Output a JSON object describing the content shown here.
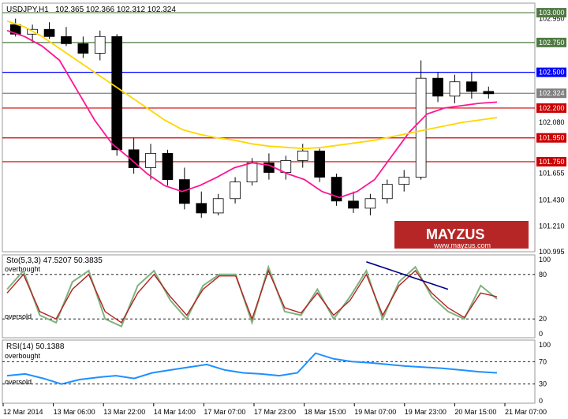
{
  "header": {
    "symbol_label": "USDJPY,H1",
    "ohlc_label": "102.365 102.366 102.312 102.324"
  },
  "brand": {
    "logo_text": "MAYZUS",
    "url": "www.mayzus.com"
  },
  "colors": {
    "candle_up": "#ffffff",
    "candle_down": "#000000",
    "candle_outline": "#000000",
    "fast_ma": "#ff1493",
    "slow_ma": "#ffd700",
    "sto_main": "#7fb27f",
    "sto_signal": "#b22222",
    "rsi_line": "#1e90ff",
    "trend_line": "#00008b",
    "level_green": "#4f7942",
    "level_blue": "#0000ff",
    "level_red": "#cc0000",
    "level_gray": "#808080"
  },
  "chart_data": [
    {
      "type": "candlestick",
      "panel": "price",
      "timeframe": "H1",
      "ylim": [
        100.995,
        103.08
      ],
      "y_ticks": [
        "103.000",
        "102.950",
        "102.750",
        "102.500",
        "102.324",
        "102.200",
        "102.080",
        "101.950",
        "101.750",
        "101.655",
        "101.430",
        "101.210",
        "100.995"
      ],
      "grid": false,
      "moving_averages": [
        {
          "color": "#ff1493",
          "values": [
            102.85,
            102.8,
            102.72,
            102.6,
            102.35,
            102.1,
            101.9,
            101.78,
            101.65,
            101.55,
            101.5,
            101.55,
            101.62,
            101.7,
            101.74,
            101.72,
            101.65,
            101.6,
            101.5,
            101.45,
            101.5,
            101.6,
            101.8,
            102.0,
            102.15,
            102.2,
            102.22,
            102.24,
            102.25
          ]
        },
        {
          "color": "#ffd700",
          "values": [
            102.93,
            102.88,
            102.8,
            102.7,
            102.6,
            102.5,
            102.4,
            102.3,
            102.2,
            102.1,
            102.02,
            101.98,
            101.95,
            101.93,
            101.9,
            101.88,
            101.87,
            101.86,
            101.87,
            101.89,
            101.91,
            101.93,
            101.96,
            101.99,
            102.02,
            102.05,
            102.08,
            102.1,
            102.12
          ]
        }
      ],
      "candles": [
        {
          "o": 102.9,
          "h": 102.95,
          "l": 102.8,
          "c": 102.82
        },
        {
          "o": 102.82,
          "h": 102.9,
          "l": 102.75,
          "c": 102.86
        },
        {
          "o": 102.86,
          "h": 102.92,
          "l": 102.78,
          "c": 102.8
        },
        {
          "o": 102.8,
          "h": 102.88,
          "l": 102.72,
          "c": 102.74
        },
        {
          "o": 102.74,
          "h": 102.8,
          "l": 102.62,
          "c": 102.66
        },
        {
          "o": 102.66,
          "h": 102.85,
          "l": 102.6,
          "c": 102.8
        },
        {
          "o": 102.8,
          "h": 102.82,
          "l": 101.8,
          "c": 101.85
        },
        {
          "o": 101.85,
          "h": 101.95,
          "l": 101.65,
          "c": 101.7
        },
        {
          "o": 101.7,
          "h": 101.9,
          "l": 101.6,
          "c": 101.82
        },
        {
          "o": 101.82,
          "h": 101.85,
          "l": 101.55,
          "c": 101.6
        },
        {
          "o": 101.6,
          "h": 101.7,
          "l": 101.35,
          "c": 101.4
        },
        {
          "o": 101.4,
          "h": 101.5,
          "l": 101.28,
          "c": 101.32
        },
        {
          "o": 101.32,
          "h": 101.48,
          "l": 101.3,
          "c": 101.44
        },
        {
          "o": 101.44,
          "h": 101.62,
          "l": 101.4,
          "c": 101.58
        },
        {
          "o": 101.58,
          "h": 101.78,
          "l": 101.55,
          "c": 101.74
        },
        {
          "o": 101.74,
          "h": 101.82,
          "l": 101.6,
          "c": 101.66
        },
        {
          "o": 101.66,
          "h": 101.8,
          "l": 101.6,
          "c": 101.76
        },
        {
          "o": 101.76,
          "h": 101.9,
          "l": 101.7,
          "c": 101.84
        },
        {
          "o": 101.84,
          "h": 101.86,
          "l": 101.58,
          "c": 101.62
        },
        {
          "o": 101.62,
          "h": 101.65,
          "l": 101.38,
          "c": 101.42
        },
        {
          "o": 101.42,
          "h": 101.5,
          "l": 101.32,
          "c": 101.36
        },
        {
          "o": 101.36,
          "h": 101.48,
          "l": 101.3,
          "c": 101.44
        },
        {
          "o": 101.44,
          "h": 101.6,
          "l": 101.4,
          "c": 101.56
        },
        {
          "o": 101.56,
          "h": 101.68,
          "l": 101.5,
          "c": 101.62
        },
        {
          "o": 101.62,
          "h": 102.6,
          "l": 101.6,
          "c": 102.45
        },
        {
          "o": 102.45,
          "h": 102.5,
          "l": 102.25,
          "c": 102.3
        },
        {
          "o": 102.3,
          "h": 102.48,
          "l": 102.24,
          "c": 102.42
        },
        {
          "o": 102.42,
          "h": 102.5,
          "l": 102.28,
          "c": 102.34
        },
        {
          "o": 102.34,
          "h": 102.38,
          "l": 102.28,
          "c": 102.32
        }
      ],
      "levels": [
        {
          "label": "103.000",
          "value": 103.0,
          "color": "#4f7942"
        },
        {
          "label": "102.750",
          "value": 102.75,
          "color": "#4f7942"
        },
        {
          "label": "102.500",
          "value": 102.5,
          "color": "#0000ff"
        },
        {
          "label": "102.324",
          "value": 102.324,
          "color": "#808080"
        },
        {
          "label": "102.200",
          "value": 102.2,
          "color": "#cc0000"
        },
        {
          "label": "101.950",
          "value": 101.95,
          "color": "#cc0000"
        },
        {
          "label": "101.750",
          "value": 101.75,
          "color": "#cc0000"
        }
      ]
    },
    {
      "type": "line",
      "panel": "stochastic",
      "title": "Sto(5,3,3) 47.5207 50.3835",
      "ylim": [
        0,
        100
      ],
      "y_ticks": [
        "100",
        "80",
        "20",
        "0"
      ],
      "zone_labels": [
        "overbought",
        "oversold"
      ],
      "series": [
        {
          "values": [
            60,
            85,
            25,
            15,
            70,
            85,
            20,
            10,
            65,
            85,
            45,
            20,
            65,
            80,
            80,
            15,
            90,
            30,
            25,
            60,
            20,
            50,
            85,
            20,
            70,
            90,
            50,
            30,
            20,
            65,
            47
          ]
        },
        {
          "values": [
            55,
            80,
            30,
            20,
            60,
            80,
            30,
            15,
            55,
            80,
            50,
            25,
            60,
            78,
            78,
            20,
            85,
            35,
            28,
            55,
            25,
            45,
            80,
            25,
            65,
            85,
            55,
            35,
            22,
            55,
            50
          ]
        }
      ],
      "trend_line": [
        {
          "x": 22,
          "y": 97
        },
        {
          "x": 27,
          "y": 60
        }
      ]
    },
    {
      "type": "line",
      "panel": "rsi",
      "title": "RSI(14) 50.1388",
      "ylim": [
        0,
        100
      ],
      "y_ticks": [
        "100",
        "70",
        "30",
        "0"
      ],
      "zone_labels": [
        "overbought",
        "oversold"
      ],
      "series": [
        {
          "values": [
            45,
            48,
            40,
            30,
            38,
            42,
            45,
            40,
            50,
            55,
            60,
            65,
            55,
            50,
            48,
            45,
            50,
            85,
            75,
            70,
            68,
            65,
            62,
            60,
            58,
            55,
            52,
            50
          ]
        }
      ]
    }
  ],
  "x_axis": {
    "labels": [
      "12 Mar 2014",
      "13 Mar 06:00",
      "13 Mar 22:00",
      "14 Mar 14:00",
      "17 Mar 07:00",
      "17 Mar 23:00",
      "18 Mar 15:00",
      "19 Mar 07:00",
      "19 Mar 23:00",
      "20 Mar 15:00",
      "21 Mar 07:00"
    ]
  }
}
